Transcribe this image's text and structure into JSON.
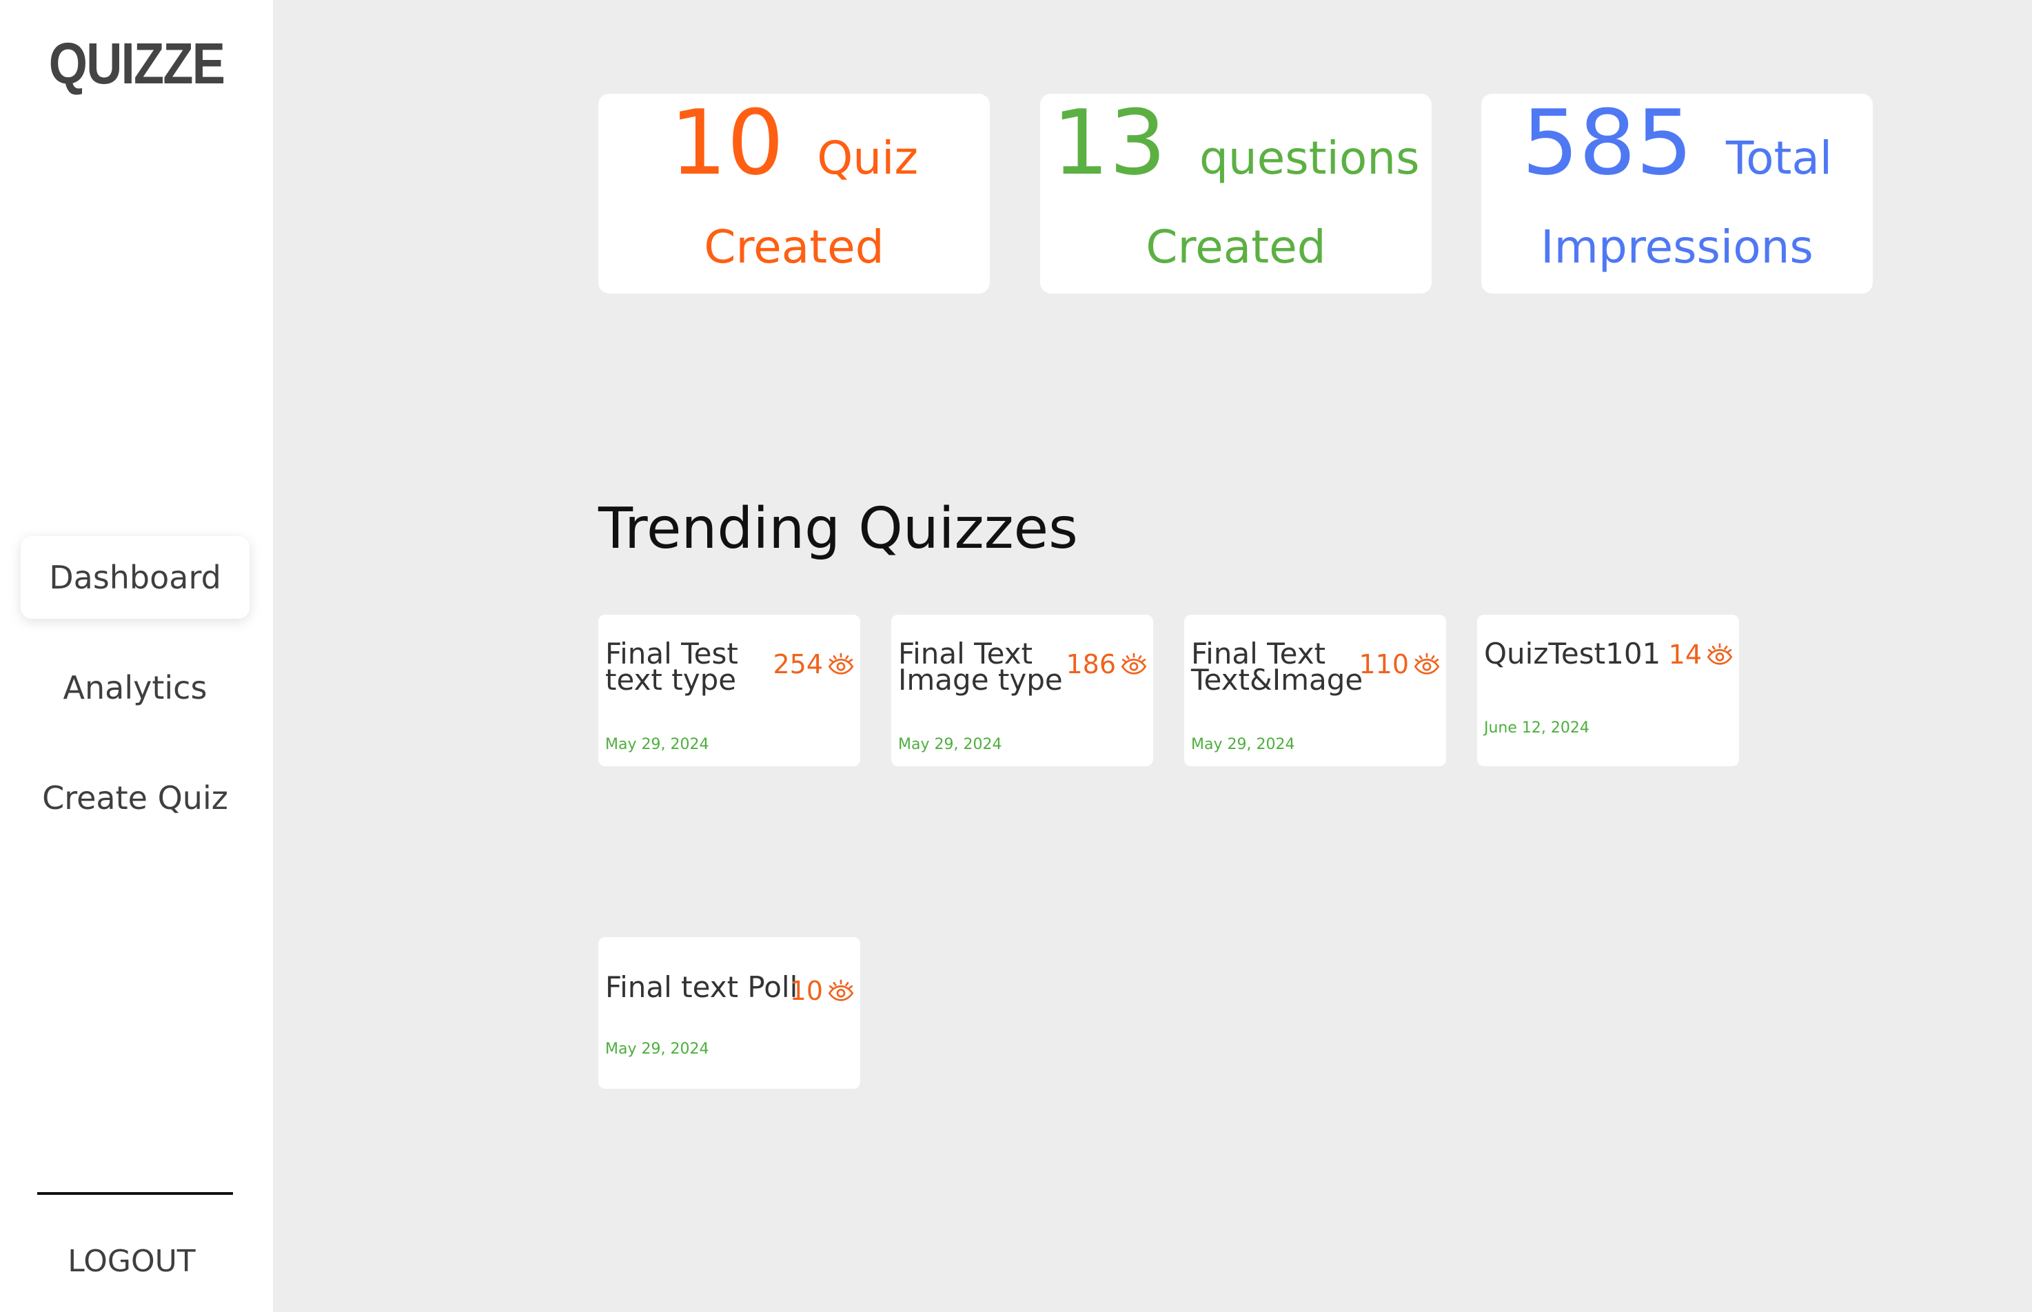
{
  "sidebar": {
    "logo": "QUIZZE",
    "nav": {
      "dashboard": "Dashboard",
      "analytics": "Analytics",
      "create_quiz": "Create Quiz"
    },
    "logout": "LOGOUT"
  },
  "stats": [
    {
      "number": "10",
      "unit": "Quiz",
      "caption": "Created",
      "color": "#fe5f13"
    },
    {
      "number": "13",
      "unit": "questions",
      "caption": "Created",
      "color": "#5cb043"
    },
    {
      "number": "585",
      "unit": "Total",
      "caption": "Impressions",
      "color": "#4f78f3"
    }
  ],
  "trending": {
    "title": "Trending Quizzes",
    "quizzes": [
      {
        "name_line1": "Final Test",
        "name_line2": "text type",
        "views": "254",
        "date": "May 29, 2024"
      },
      {
        "name_line1": "Final Text",
        "name_line2": "Image type",
        "views": "186",
        "date": "May 29, 2024"
      },
      {
        "name_line1": "Final Text",
        "name_line2": "Text&Image",
        "views": "110",
        "date": "May 29, 2024"
      },
      {
        "name_line1": "QuizTest101",
        "name_line2": "",
        "views": "14",
        "date": "June 12, 2024"
      },
      {
        "name_line1": "Final text Poll",
        "name_line2": "",
        "views": "10",
        "date": "May 29, 2024"
      }
    ]
  },
  "icons": {
    "views": "eye-icon"
  },
  "colors": {
    "views": "#f0621b",
    "date": "#4caf3c",
    "background": "#ededed"
  }
}
